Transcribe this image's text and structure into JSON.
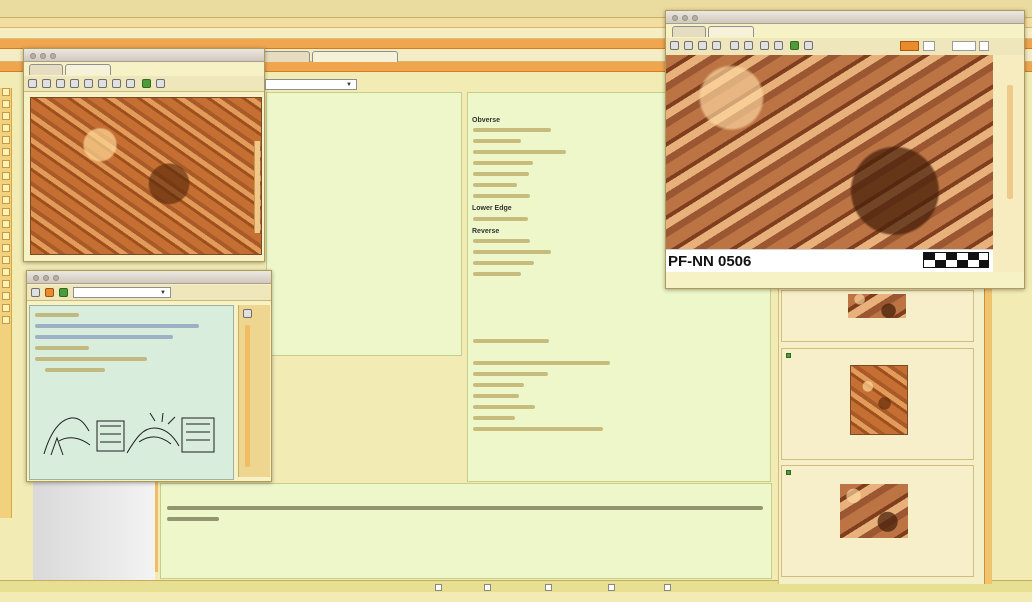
{
  "app": {
    "title": "",
    "menu_item": "",
    "breadcrumb": "",
    "center_title": "",
    "sub_toolbar": "",
    "top_tab_1": "",
    "top_tab_2": ""
  },
  "left_viewer": {
    "title": "",
    "tabs": [
      "",
      ""
    ],
    "dimensions": "",
    "zoom_label": "",
    "dropdown_value": "",
    "action_link": ""
  },
  "seal_window": {
    "title": "",
    "dropdown_value": "",
    "action_link": "",
    "side_button": "",
    "side_value": "",
    "seal_text_1": "",
    "seal_text_2": "",
    "seal_text_3": "",
    "seal_text_4": ""
  },
  "transliteration": {
    "heading": "",
    "section_obverse": "Obverse",
    "section_lower_edge": "Lower Edge",
    "section_reverse": "Reverse"
  },
  "bottom_panel": {
    "title": ""
  },
  "right_viewer": {
    "title": "",
    "tabs": [
      "",
      ""
    ],
    "dimensions": "",
    "zoom_value": "",
    "extra_label": "",
    "caption": "PF-NN 0506"
  },
  "thumbnail_cards": [
    {
      "title": "",
      "subtitle": ""
    },
    {
      "title": "",
      "subtitle": ""
    },
    {
      "title": "",
      "subtitle": ""
    }
  ],
  "left_list": {
    "items": [
      "",
      "",
      "",
      "",
      "",
      "",
      "",
      "",
      "",
      "",
      "",
      "",
      "",
      "",
      ""
    ]
  },
  "footer": {
    "left_status": "",
    "right_status": "",
    "options": [
      "",
      "",
      "",
      "",
      ""
    ]
  },
  "colors": {
    "accent_orange": "#f0b15a",
    "panel_green": "#eef7c9",
    "window_cream": "#f7f2c6"
  },
  "icons": [
    "search-icon",
    "zoom-in-icon",
    "zoom-out-icon",
    "rotate-left-icon",
    "rotate-right-icon",
    "fit-window-icon",
    "print-icon",
    "print-preview-icon",
    "save-icon",
    "color-swatch-icon"
  ]
}
